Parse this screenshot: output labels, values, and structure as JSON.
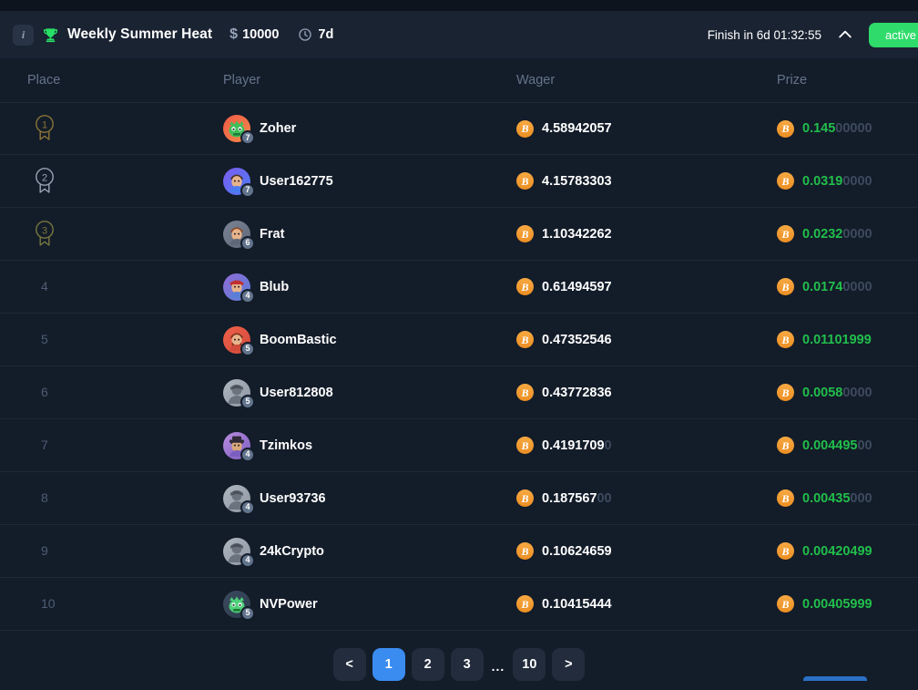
{
  "header": {
    "info_icon": "info-icon",
    "trophy_icon": "trophy-icon",
    "title": "Weekly Summer Heat",
    "prize_symbol": "$",
    "prize_amount": "10000",
    "clock_icon": "clock-icon",
    "duration": "7d",
    "finish_text": "Finish in 6d 01:32:55",
    "collapse_icon": "chevron-up-icon",
    "status_label": "active",
    "status_color": "#2fdb6a"
  },
  "table": {
    "columns": [
      "Place",
      "Player",
      "Wager",
      "Prize"
    ],
    "rows": [
      {
        "place": "1",
        "medal": "gold",
        "player": "Zoher",
        "level": "7",
        "avatar": "monster-green",
        "wager_sig": "4.58942057",
        "wager_zeros": "",
        "prize_sig": "0.145",
        "prize_zeros": "00000"
      },
      {
        "place": "2",
        "medal": "silver",
        "player": "User162775",
        "level": "7",
        "avatar": "face-purple",
        "wager_sig": "4.15783303",
        "wager_zeros": "",
        "prize_sig": "0.0319",
        "prize_zeros": "0000"
      },
      {
        "place": "3",
        "medal": "bronze",
        "player": "Frat",
        "level": "6",
        "avatar": "face-gray",
        "wager_sig": "1.10342262",
        "wager_zeros": "",
        "prize_sig": "0.0232",
        "prize_zeros": "0000"
      },
      {
        "place": "4",
        "medal": "",
        "player": "Blub",
        "level": "4",
        "avatar": "mario-purple",
        "wager_sig": "0.61494597",
        "wager_zeros": "",
        "prize_sig": "0.0174",
        "prize_zeros": "0000"
      },
      {
        "place": "5",
        "medal": "",
        "player": "BoomBastic",
        "level": "5",
        "avatar": "beard-red",
        "wager_sig": "0.47352546",
        "wager_zeros": "",
        "prize_sig": "0.01101999",
        "prize_zeros": ""
      },
      {
        "place": "6",
        "medal": "",
        "player": "User812808",
        "level": "5",
        "avatar": "default-gray",
        "wager_sig": "0.43772836",
        "wager_zeros": "",
        "prize_sig": "0.0058",
        "prize_zeros": "0000"
      },
      {
        "place": "7",
        "medal": "",
        "player": "Tzimkos",
        "level": "4",
        "avatar": "hat-purple",
        "wager_sig": "0.4191709",
        "wager_zeros": "0",
        "prize_sig": "0.004495",
        "prize_zeros": "00"
      },
      {
        "place": "8",
        "medal": "",
        "player": "User93736",
        "level": "4",
        "avatar": "default-gray",
        "wager_sig": "0.187567",
        "wager_zeros": "00",
        "prize_sig": "0.00435",
        "prize_zeros": "000"
      },
      {
        "place": "9",
        "medal": "",
        "player": "24kCrypto",
        "level": "4",
        "avatar": "default-gray",
        "wager_sig": "0.10624659",
        "wager_zeros": "",
        "prize_sig": "0.00420499",
        "prize_zeros": ""
      },
      {
        "place": "10",
        "medal": "",
        "player": "NVPower",
        "level": "5",
        "avatar": "monster-green2",
        "wager_sig": "0.10415444",
        "wager_zeros": "",
        "prize_sig": "0.00405999",
        "prize_zeros": ""
      }
    ]
  },
  "pagination": {
    "prev_label": "<",
    "next_label": ">",
    "ellipsis": "...",
    "pages": [
      "1",
      "2",
      "3"
    ],
    "last_page": "10",
    "current_page": "1",
    "active_color": "#3b8cf0"
  }
}
